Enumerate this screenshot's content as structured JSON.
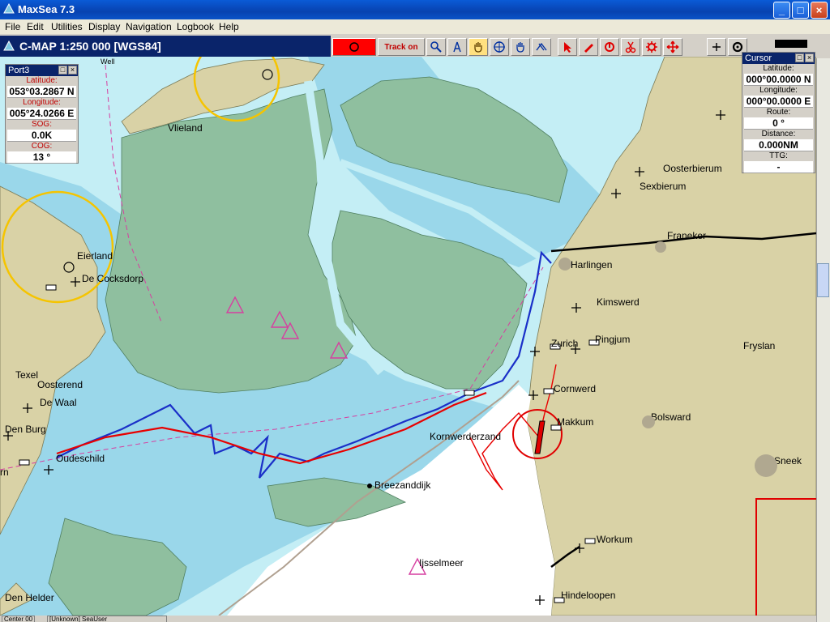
{
  "window": {
    "title": "MaxSea 7.3"
  },
  "menu": [
    "File",
    "Edit",
    "Utilities",
    "Display",
    "Navigation",
    "Logbook",
    "Help"
  ],
  "chart_header": {
    "title": "C-MAP  1:250 000 [WGS84]"
  },
  "toolbar": {
    "track_label": "Track on",
    "icons": [
      "record-icon",
      "magnifier-icon",
      "compass-icon",
      "hand-icon",
      "crosshair-icon",
      "grab-icon",
      "route-icon",
      "pointer-icon",
      "pencil-icon",
      "erase-icon",
      "scissors-icon",
      "gear-icon",
      "move-icon",
      "plus-icon",
      "settings-icon"
    ]
  },
  "port_panel": {
    "title": "Port3",
    "fields": [
      {
        "label": "Latitude:",
        "value": "053°03.2867 N"
      },
      {
        "label": "Longitude:",
        "value": "005°24.0266 E"
      },
      {
        "label": "SOG:",
        "value": "0.0K"
      },
      {
        "label": "COG:",
        "value": "13 °"
      }
    ]
  },
  "cursor_panel": {
    "title": "Cursor",
    "fields": [
      {
        "label": "Latitude:",
        "value": "000°00.0000 N"
      },
      {
        "label": "Longitude:",
        "value": "000°00.0000 E"
      },
      {
        "label": "Route:",
        "value": "0 °"
      },
      {
        "label": "Distance:",
        "value": "0.000NM"
      },
      {
        "label": "TTG:",
        "value": "-"
      }
    ]
  },
  "map": {
    "places": {
      "vlieland": "Vlieland",
      "eierland": "Eierland",
      "de_cocksdorp": "De Cocksdorp",
      "texel": "Texel",
      "oosterend": "Oosterend",
      "de_waal": "De Waal",
      "den_burg": "Den Burg",
      "oudeschild": "Oudeschild",
      "den_helder": "Den Helder",
      "oosterbierum": "Oosterbierum",
      "sexbierum": "Sexbierum",
      "franeker": "Franeker",
      "harlingen": "Harlingen",
      "kimswerd": "Kimswerd",
      "zurich": "Zurich",
      "pingjum": "Pingjum",
      "fryslan": "Fryslan",
      "cornwerd": "Cornwerd",
      "makkum": "Makkum",
      "bolsward": "Bolsward",
      "kornwerderzand": "Kornwerderzand",
      "breezanddijk": "Breezanddijk",
      "sneek": "Sneek",
      "ijsselmeer": "Ijsselmeer",
      "workum": "Workum",
      "hindeloopen": "Hindeloopen",
      "rn": "rn",
      "well": "Well"
    }
  },
  "status": {
    "left": "Center 00",
    "middle": "[Unknown]  SeaUser"
  },
  "colors": {
    "land": "#d9d2a6",
    "shoal": "#8fbf9f",
    "deep": "#c4eef5",
    "shallow": "#9ad7ea",
    "track_red": "#e80000",
    "track_blue": "#1a2fc8"
  }
}
